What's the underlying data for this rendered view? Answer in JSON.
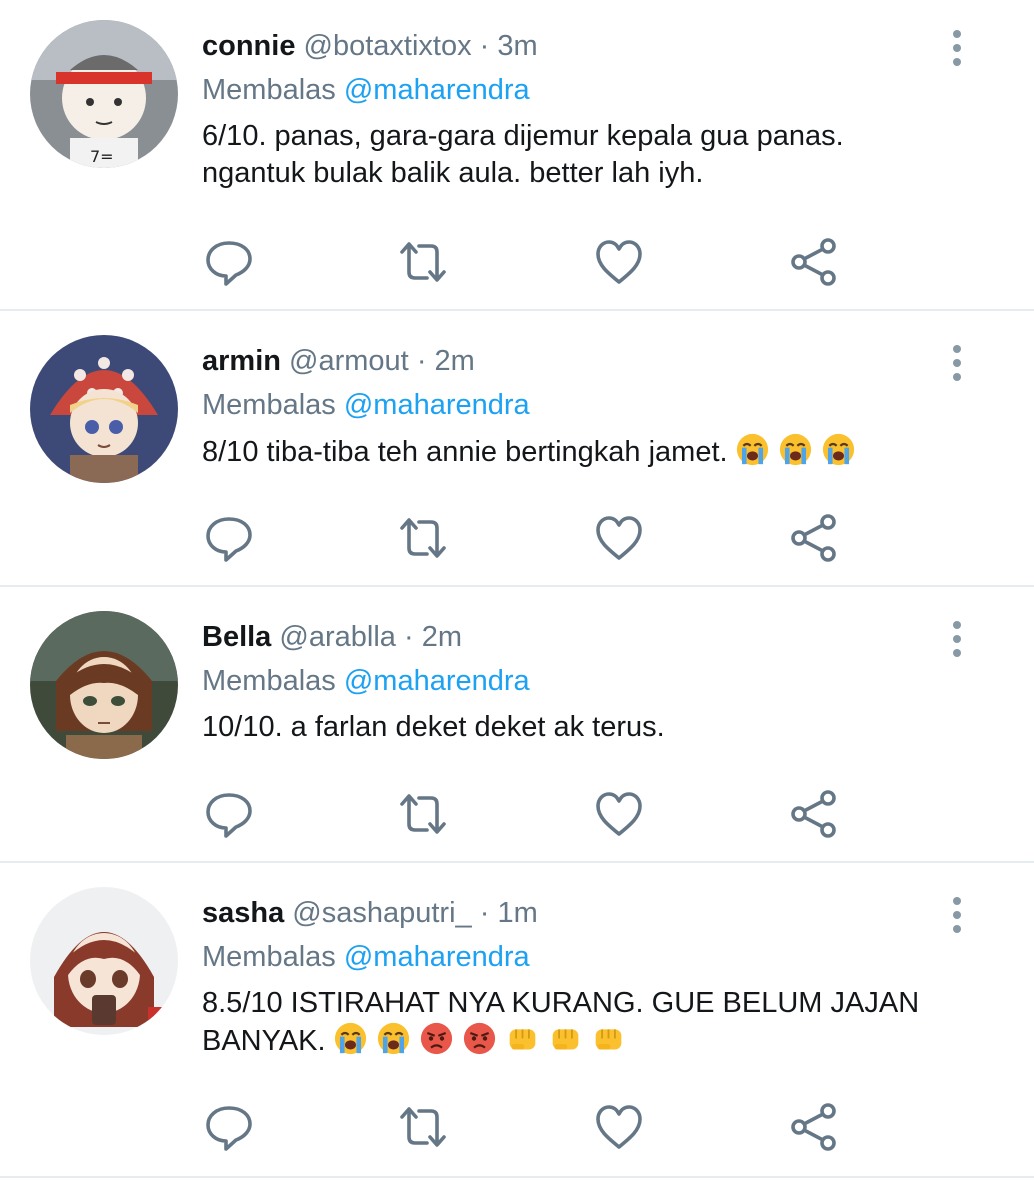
{
  "tweets": [
    {
      "name": "connie",
      "handle": "@botaxtixtox",
      "separator": "·",
      "time": "3m",
      "reply_prefix": "Membalas",
      "reply_to": "@maharendra",
      "text": "6/10. panas, gara-gara dijemur kepala gua panas. ngantuk bulak balik aula. better lah iyh.",
      "emojis": []
    },
    {
      "name": "armin",
      "handle": "@armout",
      "separator": "·",
      "time": "2m",
      "reply_prefix": "Membalas",
      "reply_to": "@maharendra",
      "text": "8/10 tiba-tiba teh annie bertingkah jamet.",
      "emojis": [
        "loudly-crying-face",
        "loudly-crying-face",
        "loudly-crying-face"
      ]
    },
    {
      "name": "Bella",
      "handle": "@arablla",
      "separator": "·",
      "time": "2m",
      "reply_prefix": "Membalas",
      "reply_to": "@maharendra",
      "text": "10/10. a farlan deket deket ak terus.",
      "emojis": []
    },
    {
      "name": "sasha",
      "handle": "@sashaputri_",
      "separator": "·",
      "time": "1m",
      "reply_prefix": "Membalas",
      "reply_to": "@maharendra",
      "text": "8.5/10 ISTIRAHAT NYA KURANG. GUE BELUM JAJAN BANYAK.",
      "emojis": [
        "loudly-crying-face",
        "loudly-crying-face",
        "pouting-face",
        "pouting-face",
        "oncoming-fist",
        "oncoming-fist",
        "oncoming-fist"
      ]
    }
  ],
  "icons": {
    "reply": "reply-icon",
    "retweet": "retweet-icon",
    "like": "heart-icon",
    "share": "share-icon",
    "more": "more-vertical-icon"
  },
  "colors": {
    "text": "#14171a",
    "secondary": "#657786",
    "link": "#1da1f2",
    "icon": "#657786",
    "divider": "#e6ecf0"
  }
}
